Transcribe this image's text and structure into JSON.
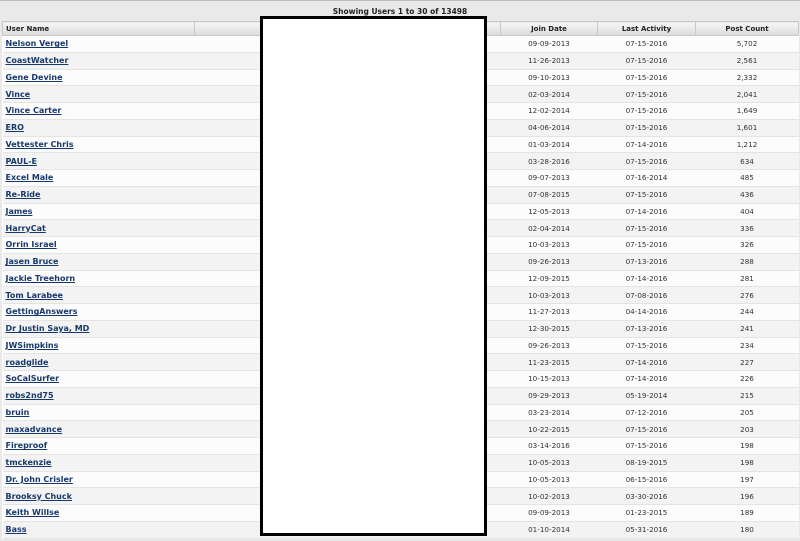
{
  "caption": "Showing Users 1 to 30 of 13498",
  "columns": {
    "user_name": "User Name",
    "join_date": "Join Date",
    "last_activity": "Last Activity",
    "post_count": "Post Count"
  },
  "rows": [
    {
      "name": "Nelson Vergel",
      "join": "09-09-2013",
      "last": "07-15-2016",
      "posts": "5,702"
    },
    {
      "name": "CoastWatcher",
      "join": "11-26-2013",
      "last": "07-15-2016",
      "posts": "2,561"
    },
    {
      "name": "Gene Devine",
      "join": "09-10-2013",
      "last": "07-15-2016",
      "posts": "2,332"
    },
    {
      "name": "Vince",
      "join": "02-03-2014",
      "last": "07-15-2016",
      "posts": "2,041"
    },
    {
      "name": "Vince Carter",
      "join": "12-02-2014",
      "last": "07-15-2016",
      "posts": "1,649"
    },
    {
      "name": "ERO",
      "join": "04-06-2014",
      "last": "07-15-2016",
      "posts": "1,601"
    },
    {
      "name": "Vettester Chris",
      "join": "01-03-2014",
      "last": "07-14-2016",
      "posts": "1,212"
    },
    {
      "name": "PAUL-E",
      "join": "03-28-2016",
      "last": "07-15-2016",
      "posts": "634"
    },
    {
      "name": "Excel Male",
      "join": "09-07-2013",
      "last": "07-16-2014",
      "posts": "485"
    },
    {
      "name": "Re-Ride",
      "join": "07-08-2015",
      "last": "07-15-2016",
      "posts": "436"
    },
    {
      "name": "James",
      "join": "12-05-2013",
      "last": "07-14-2016",
      "posts": "404"
    },
    {
      "name": "HarryCat",
      "join": "02-04-2014",
      "last": "07-15-2016",
      "posts": "336"
    },
    {
      "name": "Orrin Israel",
      "join": "10-03-2013",
      "last": "07-15-2016",
      "posts": "326"
    },
    {
      "name": "Jasen Bruce",
      "join": "09-26-2013",
      "last": "07-13-2016",
      "posts": "288"
    },
    {
      "name": "Jackie Treehorn",
      "join": "12-09-2015",
      "last": "07-14-2016",
      "posts": "281"
    },
    {
      "name": "Tom Larabee",
      "join": "10-03-2013",
      "last": "07-08-2016",
      "posts": "276"
    },
    {
      "name": "GettingAnswers",
      "join": "11-27-2013",
      "last": "04-14-2016",
      "posts": "244"
    },
    {
      "name": "Dr Justin Saya, MD",
      "join": "12-30-2015",
      "last": "07-13-2016",
      "posts": "241"
    },
    {
      "name": "JWSimpkins",
      "join": "09-26-2013",
      "last": "07-15-2016",
      "posts": "234"
    },
    {
      "name": "roadglide",
      "join": "11-23-2015",
      "last": "07-14-2016",
      "posts": "227"
    },
    {
      "name": "SoCalSurfer",
      "join": "10-15-2013",
      "last": "07-14-2016",
      "posts": "226"
    },
    {
      "name": "robs2nd75",
      "join": "09-29-2013",
      "last": "05-19-2014",
      "posts": "215"
    },
    {
      "name": "bruin",
      "join": "03-23-2014",
      "last": "07-12-2016",
      "posts": "205"
    },
    {
      "name": "maxadvance",
      "join": "10-22-2015",
      "last": "07-15-2016",
      "posts": "203"
    },
    {
      "name": "Fireproof",
      "join": "03-14-2016",
      "last": "07-15-2016",
      "posts": "198"
    },
    {
      "name": "tmckenzie",
      "join": "10-05-2013",
      "last": "08-19-2015",
      "posts": "198"
    },
    {
      "name": "Dr. John Crisler",
      "join": "10-05-2013",
      "last": "06-15-2016",
      "posts": "197"
    },
    {
      "name": "Brooksy Chuck",
      "join": "10-02-2013",
      "last": "03-30-2016",
      "posts": "196"
    },
    {
      "name": "Keith Willse",
      "join": "09-09-2013",
      "last": "01-23-2015",
      "posts": "189"
    },
    {
      "name": "Bass",
      "join": "01-10-2014",
      "last": "05-31-2016",
      "posts": "180"
    }
  ]
}
